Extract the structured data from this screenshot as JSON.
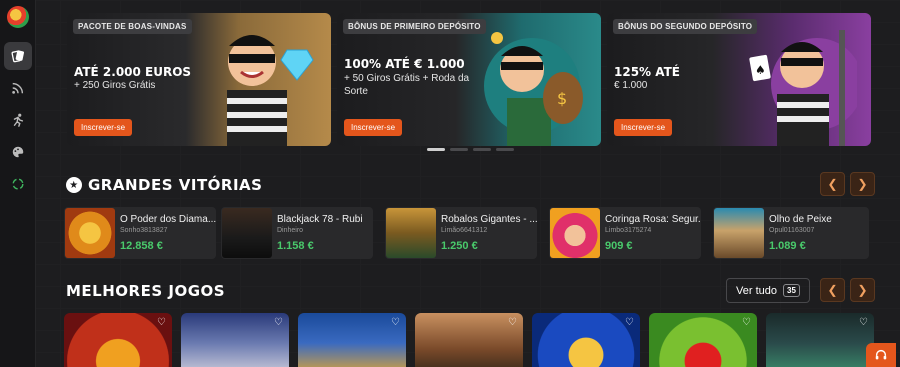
{
  "banners": [
    {
      "tag": "PACOTE DE BOAS-VINDAS",
      "title": "ATÉ 2.000 EUROS",
      "subtitle": "+ 250 Giros Grátis",
      "button": "Inscrever-se"
    },
    {
      "tag": "BÔNUS DE PRIMEIRO DEPÓSITO",
      "title": "100% ATÉ € 1.000",
      "subtitle": "+ 50 Giros Grátis + Roda da Sorte",
      "button": "Inscrever-se"
    },
    {
      "tag": "BÔNUS DO SEGUNDO DEPÓSITO",
      "title": "125% ATÉ",
      "subtitle": "€ 1.000",
      "button": "Inscrever-se"
    }
  ],
  "carousel": {
    "active_index": 0,
    "count": 4
  },
  "big_wins": {
    "title": "GRANDES VITÓRIAS",
    "items": [
      {
        "game": "O Poder dos Diama...",
        "user": "Sonho3813827",
        "amount": "12.858 €"
      },
      {
        "game": "Blackjack 78 - Rubi",
        "user": "Dinheiro",
        "amount": "1.158 €"
      },
      {
        "game": "Robalos Gigantes - ...",
        "user": "Limão6641312",
        "amount": "1.250 €"
      },
      {
        "game": "Coringa Rosa: Segur...",
        "user": "Limbo3175274",
        "amount": "909 €"
      },
      {
        "game": "Olho de Peixe",
        "user": "Opul01163007",
        "amount": "1.089 €"
      }
    ]
  },
  "best_games": {
    "title": "MELHORES JOGOS",
    "view_all_label": "Ver tudo",
    "view_all_count": "35"
  },
  "icons": {
    "prev": "chevron-left-icon",
    "next": "chevron-right-icon",
    "favorite": "heart-icon",
    "support": "headset-icon"
  },
  "colors": {
    "accent": "#e4561c",
    "win_amount": "#49c96b"
  }
}
